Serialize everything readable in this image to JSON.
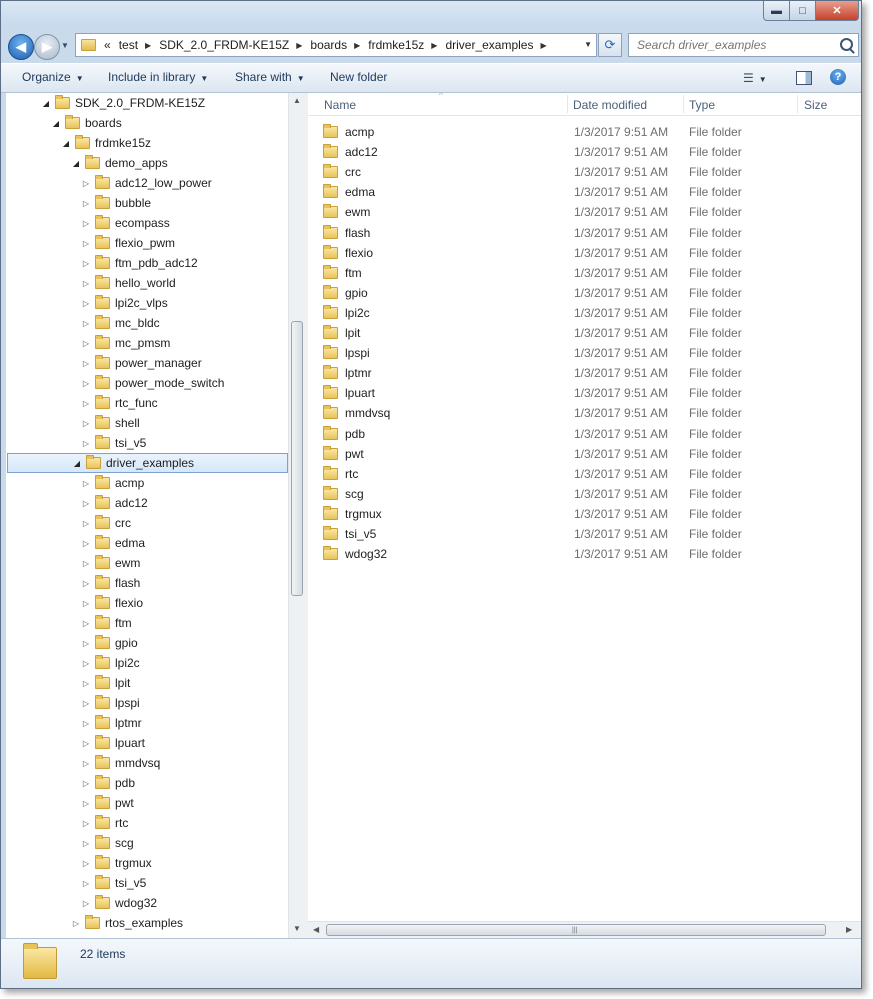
{
  "window": {
    "controls": {
      "minimize": "▬",
      "maximize": "□",
      "close": "✕"
    }
  },
  "nav": {
    "back": "◀",
    "forward": "▶",
    "history": "▼",
    "breadcrumb_prefix": "«",
    "breadcrumb": [
      "test",
      "SDK_2.0_FRDM-KE15Z",
      "boards",
      "frdmke15z",
      "driver_examples"
    ],
    "breadcrumb_sep": "▶",
    "dropdown": "▼",
    "refresh": "⟳",
    "search_placeholder": "Search driver_examples"
  },
  "toolbar": {
    "organize": "Organize",
    "include_in_library": "Include in library",
    "share_with": "Share with",
    "new_folder": "New folder",
    "arrow": "▼",
    "view_icon": "☰",
    "view_arrow": "▼",
    "help": "?"
  },
  "tree": {
    "collapsed_glyph": "▷",
    "expanded_glyph": "◢",
    "items": [
      {
        "label": "SDK_2.0_FRDM-KE15Z",
        "depth": 0,
        "state": "expanded"
      },
      {
        "label": "boards",
        "depth": 1,
        "state": "expanded"
      },
      {
        "label": "frdmke15z",
        "depth": 2,
        "state": "expanded"
      },
      {
        "label": "demo_apps",
        "depth": 3,
        "state": "expanded"
      },
      {
        "label": "adc12_low_power",
        "depth": 4,
        "state": "collapsed"
      },
      {
        "label": "bubble",
        "depth": 4,
        "state": "collapsed"
      },
      {
        "label": "ecompass",
        "depth": 4,
        "state": "collapsed"
      },
      {
        "label": "flexio_pwm",
        "depth": 4,
        "state": "collapsed"
      },
      {
        "label": "ftm_pdb_adc12",
        "depth": 4,
        "state": "collapsed"
      },
      {
        "label": "hello_world",
        "depth": 4,
        "state": "collapsed"
      },
      {
        "label": "lpi2c_vlps",
        "depth": 4,
        "state": "collapsed"
      },
      {
        "label": "mc_bldc",
        "depth": 4,
        "state": "collapsed"
      },
      {
        "label": "mc_pmsm",
        "depth": 4,
        "state": "collapsed"
      },
      {
        "label": "power_manager",
        "depth": 4,
        "state": "collapsed"
      },
      {
        "label": "power_mode_switch",
        "depth": 4,
        "state": "collapsed"
      },
      {
        "label": "rtc_func",
        "depth": 4,
        "state": "collapsed"
      },
      {
        "label": "shell",
        "depth": 4,
        "state": "collapsed"
      },
      {
        "label": "tsi_v5",
        "depth": 4,
        "state": "collapsed"
      },
      {
        "label": "driver_examples",
        "depth": 3,
        "state": "expanded",
        "selected": true
      },
      {
        "label": "acmp",
        "depth": 4,
        "state": "collapsed"
      },
      {
        "label": "adc12",
        "depth": 4,
        "state": "collapsed"
      },
      {
        "label": "crc",
        "depth": 4,
        "state": "collapsed"
      },
      {
        "label": "edma",
        "depth": 4,
        "state": "collapsed"
      },
      {
        "label": "ewm",
        "depth": 4,
        "state": "collapsed"
      },
      {
        "label": "flash",
        "depth": 4,
        "state": "collapsed"
      },
      {
        "label": "flexio",
        "depth": 4,
        "state": "collapsed"
      },
      {
        "label": "ftm",
        "depth": 4,
        "state": "collapsed"
      },
      {
        "label": "gpio",
        "depth": 4,
        "state": "collapsed"
      },
      {
        "label": "lpi2c",
        "depth": 4,
        "state": "collapsed"
      },
      {
        "label": "lpit",
        "depth": 4,
        "state": "collapsed"
      },
      {
        "label": "lpspi",
        "depth": 4,
        "state": "collapsed"
      },
      {
        "label": "lptmr",
        "depth": 4,
        "state": "collapsed"
      },
      {
        "label": "lpuart",
        "depth": 4,
        "state": "collapsed"
      },
      {
        "label": "mmdvsq",
        "depth": 4,
        "state": "collapsed"
      },
      {
        "label": "pdb",
        "depth": 4,
        "state": "collapsed"
      },
      {
        "label": "pwt",
        "depth": 4,
        "state": "collapsed"
      },
      {
        "label": "rtc",
        "depth": 4,
        "state": "collapsed"
      },
      {
        "label": "scg",
        "depth": 4,
        "state": "collapsed"
      },
      {
        "label": "trgmux",
        "depth": 4,
        "state": "collapsed"
      },
      {
        "label": "tsi_v5",
        "depth": 4,
        "state": "collapsed"
      },
      {
        "label": "wdog32",
        "depth": 4,
        "state": "collapsed"
      },
      {
        "label": "rtos_examples",
        "depth": 3,
        "state": "collapsed"
      }
    ]
  },
  "scroll": {
    "up": "▲",
    "down": "▼",
    "left": "◀",
    "right": "▶",
    "grip": "≡",
    "hgrip": "|||"
  },
  "columns": {
    "name": "Name",
    "date_modified": "Date modified",
    "type": "Type",
    "size": "Size",
    "sort_indicator": "^"
  },
  "files": [
    {
      "name": "acmp",
      "date": "1/3/2017 9:51 AM",
      "type": "File folder"
    },
    {
      "name": "adc12",
      "date": "1/3/2017 9:51 AM",
      "type": "File folder"
    },
    {
      "name": "crc",
      "date": "1/3/2017 9:51 AM",
      "type": "File folder"
    },
    {
      "name": "edma",
      "date": "1/3/2017 9:51 AM",
      "type": "File folder"
    },
    {
      "name": "ewm",
      "date": "1/3/2017 9:51 AM",
      "type": "File folder"
    },
    {
      "name": "flash",
      "date": "1/3/2017 9:51 AM",
      "type": "File folder"
    },
    {
      "name": "flexio",
      "date": "1/3/2017 9:51 AM",
      "type": "File folder"
    },
    {
      "name": "ftm",
      "date": "1/3/2017 9:51 AM",
      "type": "File folder"
    },
    {
      "name": "gpio",
      "date": "1/3/2017 9:51 AM",
      "type": "File folder"
    },
    {
      "name": "lpi2c",
      "date": "1/3/2017 9:51 AM",
      "type": "File folder"
    },
    {
      "name": "lpit",
      "date": "1/3/2017 9:51 AM",
      "type": "File folder"
    },
    {
      "name": "lpspi",
      "date": "1/3/2017 9:51 AM",
      "type": "File folder"
    },
    {
      "name": "lptmr",
      "date": "1/3/2017 9:51 AM",
      "type": "File folder"
    },
    {
      "name": "lpuart",
      "date": "1/3/2017 9:51 AM",
      "type": "File folder"
    },
    {
      "name": "mmdvsq",
      "date": "1/3/2017 9:51 AM",
      "type": "File folder"
    },
    {
      "name": "pdb",
      "date": "1/3/2017 9:51 AM",
      "type": "File folder"
    },
    {
      "name": "pwt",
      "date": "1/3/2017 9:51 AM",
      "type": "File folder"
    },
    {
      "name": "rtc",
      "date": "1/3/2017 9:51 AM",
      "type": "File folder"
    },
    {
      "name": "scg",
      "date": "1/3/2017 9:51 AM",
      "type": "File folder"
    },
    {
      "name": "trgmux",
      "date": "1/3/2017 9:51 AM",
      "type": "File folder"
    },
    {
      "name": "tsi_v5",
      "date": "1/3/2017 9:51 AM",
      "type": "File folder"
    },
    {
      "name": "wdog32",
      "date": "1/3/2017 9:51 AM",
      "type": "File folder"
    }
  ],
  "status": {
    "item_count": "22 items"
  },
  "colors": {
    "selection": "#d5e7fa",
    "selection_border": "#7da2ce",
    "chrome": "#c9daea",
    "folder": "#e8c35a"
  }
}
